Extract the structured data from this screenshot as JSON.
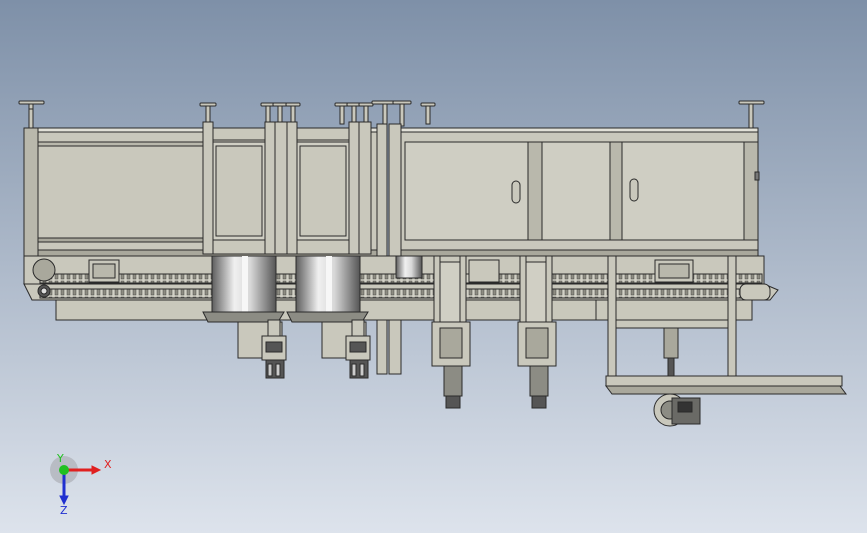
{
  "viewport": {
    "background_top": "#7e90a8",
    "background_bottom": "#dde3ec",
    "body_fill": "#c9c8bc",
    "body_fill_dark": "#a9a89c",
    "body_fill_light": "#e2e1d8",
    "edge_color": "#2a2a2a",
    "metal_light": "#e6e6e6",
    "metal_dark": "#6c6c6c"
  },
  "triad": {
    "x_label": "X",
    "y_label": "Y",
    "z_label": "Z",
    "x_color": "#e02020",
    "y_color": "#20c020",
    "z_color": "#2030d0"
  }
}
